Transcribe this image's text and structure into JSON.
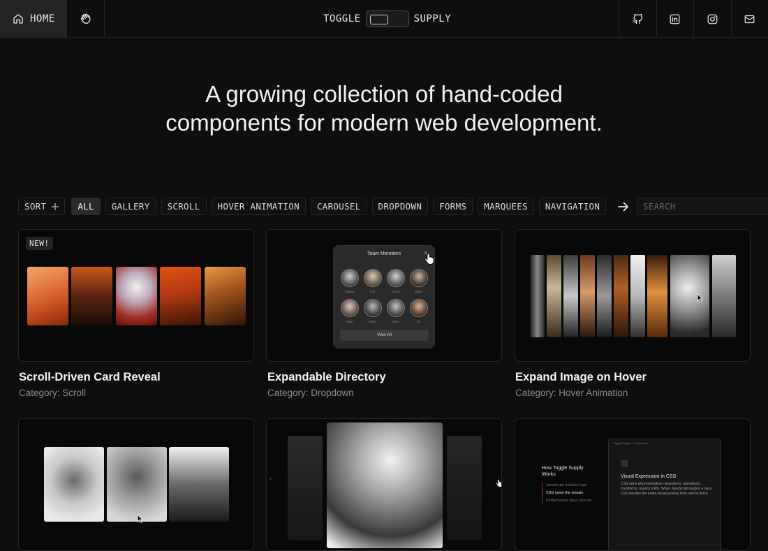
{
  "nav": {
    "home_label": "HOME",
    "brand_left": "TOGGLE",
    "brand_right": "SUPPLY",
    "icons": [
      "home-icon",
      "waving-hand-icon",
      "github-icon",
      "linkedin-icon",
      "instagram-icon",
      "mail-icon"
    ]
  },
  "hero": {
    "line1": "A growing collection of hand-coded",
    "line2": "components for modern web development."
  },
  "filters": {
    "sort_label": "SORT",
    "chips": [
      "ALL",
      "GALLERY",
      "SCROLL",
      "HOVER ANIMATION",
      "CAROUSEL",
      "DROPDOWN",
      "FORMS",
      "MARQUEES",
      "NAVIGATION"
    ],
    "active": "ALL",
    "search_placeholder": "SEARCH"
  },
  "cards": [
    {
      "title": "Scroll-Driven Card Reveal",
      "category": "Category: Scroll",
      "badge": "NEW!"
    },
    {
      "title": "Expandable Directory",
      "category": "Category: Dropdown"
    },
    {
      "title": "Expand Image on Hover",
      "category": "Category: Hover Animation"
    },
    {
      "title": "",
      "category": ""
    },
    {
      "title": "",
      "category": ""
    },
    {
      "title": "",
      "category": ""
    }
  ],
  "directory_preview": {
    "title": "Team Members",
    "members": [
      "Shawn",
      "Zoe",
      "Grant",
      "Maya",
      "Kate",
      "Owen",
      "Nora",
      "Eli"
    ],
    "button": "View All"
  },
  "howto_preview": {
    "breadcrumb": "Toggle Supply  >  Techniques",
    "heading": "How Toggle Supply Works",
    "steps": [
      "JavaScript handles logic",
      "CSS owns the visuals",
      "Performance stays smooth"
    ],
    "doc_title": "Visual Expression in CSS",
    "doc_body": "CSS owns all presentation—transitions, animations, transforms, opacity shifts. When JavaScript toggles a class, CSS handles the entire visual journey from start to finish."
  },
  "colors": {
    "background": "#0e0e0e",
    "nav_active": "#242424",
    "chip_active": "#2b2b2b",
    "muted_text": "#8a8a8a"
  }
}
